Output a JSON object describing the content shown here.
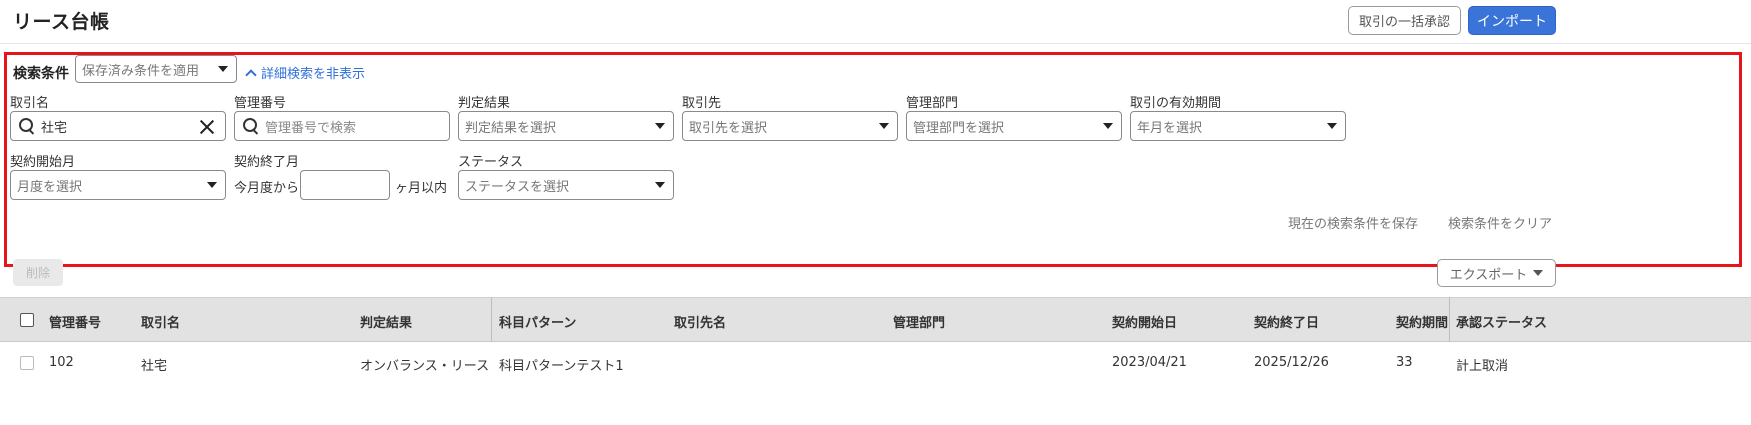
{
  "header": {
    "title": "リース台帳",
    "bulk_approve_label": "取引の一括承認",
    "import_label": "インポート"
  },
  "search": {
    "title": "検索条件",
    "saved_conditions_placeholder": "保存済み条件を適用",
    "toggle_label": "詳細検索を非表示",
    "fields": {
      "transaction_name": {
        "label": "取引名",
        "value": "社宅"
      },
      "management_number": {
        "label": "管理番号",
        "placeholder": "管理番号で検索"
      },
      "judgement": {
        "label": "判定結果",
        "placeholder": "判定結果を選択"
      },
      "partner": {
        "label": "取引先",
        "placeholder": "取引先を選択"
      },
      "department": {
        "label": "管理部門",
        "placeholder": "管理部門を選択"
      },
      "valid_period": {
        "label": "取引の有効期間",
        "placeholder": "年月を選択"
      },
      "contract_start": {
        "label": "契約開始月",
        "placeholder": "月度を選択"
      },
      "contract_end": {
        "label": "契約終了月",
        "prefix": "今月度から",
        "suffix": "ヶ月以内",
        "value": ""
      },
      "status": {
        "label": "ステータス",
        "placeholder": "ステータスを選択"
      }
    },
    "save_link": "現在の検索条件を保存",
    "clear_link": "検索条件をクリア"
  },
  "actions": {
    "delete_label": "削除",
    "export_label": "エクスポート"
  },
  "table": {
    "columns": [
      "管理番号",
      "取引名",
      "判定結果",
      "科目パターン",
      "取引先名",
      "管理部門",
      "契約開始日",
      "契約終了日",
      "契約期間",
      "承認ステータス"
    ],
    "rows": [
      {
        "management_number": "102",
        "transaction_name": "社宅",
        "judgement": "オンバランス・リース",
        "account_pattern": "科目パターンテスト1",
        "partner_name": "",
        "department": "",
        "contract_start": "2023/04/21",
        "contract_end": "2025/12/26",
        "contract_period": "33",
        "approval_status": "計上取消"
      }
    ]
  },
  "colors": {
    "primary": "#3b74d8",
    "highlight_border": "#e8141c",
    "link": "#2f6fd6",
    "table_header_bg": "#e2e2e2"
  }
}
